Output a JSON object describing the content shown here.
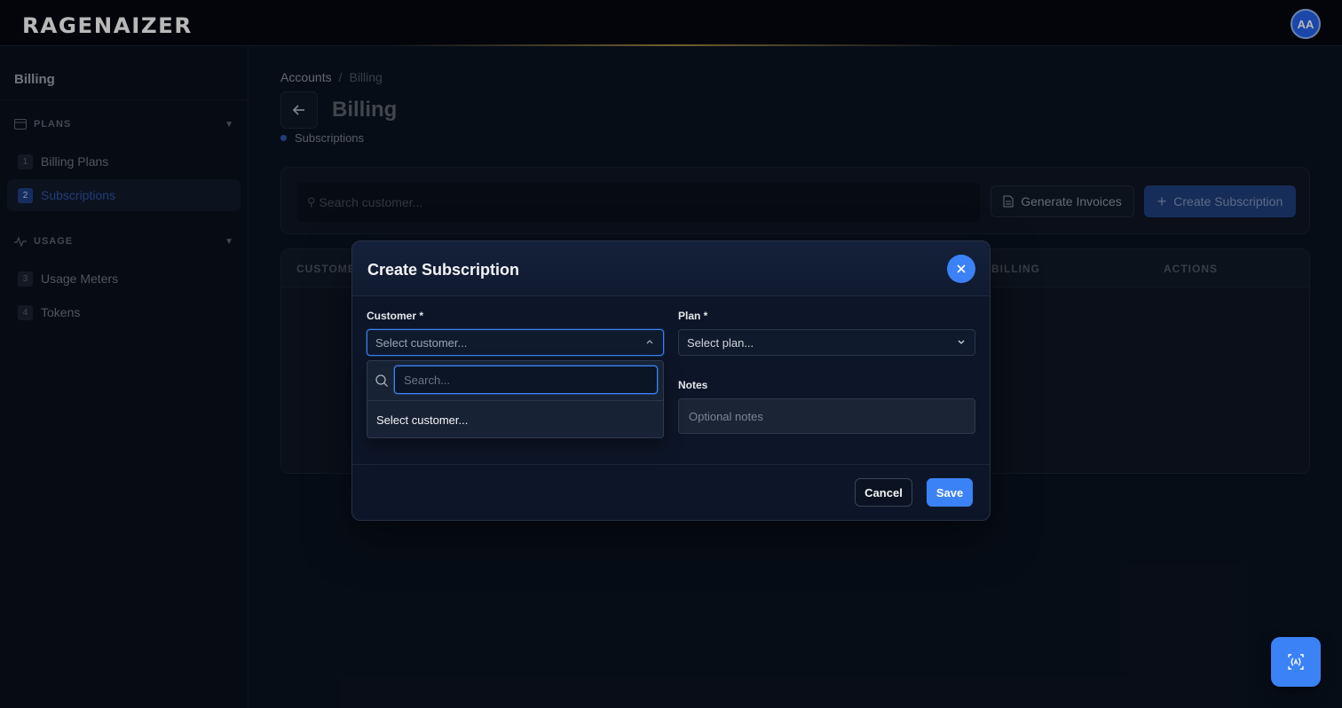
{
  "app": {
    "logo": "RAGENAIZER",
    "avatar_initials": "AA"
  },
  "sidebar": {
    "title": "Billing",
    "sections": [
      {
        "label": "PLANS",
        "icon": "card-icon",
        "items": [
          {
            "num": "1",
            "label": "Billing Plans"
          },
          {
            "num": "2",
            "label": "Subscriptions",
            "active": true
          }
        ]
      },
      {
        "label": "USAGE",
        "icon": "activity-icon",
        "items": [
          {
            "num": "3",
            "label": "Usage Meters"
          },
          {
            "num": "4",
            "label": "Tokens"
          }
        ]
      }
    ]
  },
  "breadcrumb": {
    "parent": "Accounts",
    "separator": "/",
    "current": "Billing"
  },
  "page": {
    "title": "Billing",
    "subtitle": "Subscriptions"
  },
  "toolbar": {
    "search_placeholder": "Search customer...",
    "generate_label": "Generate Invoices",
    "create_label": "Create Subscription"
  },
  "table": {
    "columns": [
      "CUSTOMER",
      "BILLING",
      "ACTIONS"
    ]
  },
  "modal": {
    "title": "Create Subscription",
    "customer_label": "Customer *",
    "customer_placeholder": "Select customer...",
    "plan_label": "Plan *",
    "plan_placeholder": "Select plan...",
    "notes_label": "Notes",
    "notes_placeholder": "Optional notes",
    "cancel_label": "Cancel",
    "save_label": "Save",
    "dropdown": {
      "search_placeholder": "Search...",
      "options": [
        "Select customer..."
      ]
    }
  },
  "colors": {
    "accent": "#3b82f6",
    "background": "#0b1220",
    "active_nav": "#2f55a8"
  }
}
